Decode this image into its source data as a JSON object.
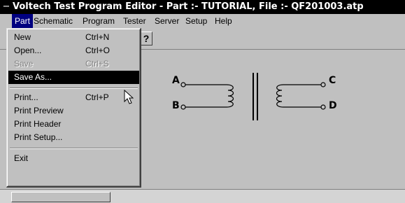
{
  "window": {
    "title": "Voltech Test Program Editor - Part :- TUTORIAL, File :- QF201003.atp",
    "system_icon": "minus-icon"
  },
  "menubar": {
    "items": [
      {
        "label": "Part"
      },
      {
        "label": "Schematic"
      },
      {
        "label": "Program"
      },
      {
        "label": "Tester"
      },
      {
        "label": "Server"
      },
      {
        "label": "Setup"
      },
      {
        "label": "Help"
      }
    ]
  },
  "toolbar": {
    "help_glyph": "?"
  },
  "part_menu": {
    "items": [
      {
        "label": "New",
        "shortcut": "Ctrl+N",
        "state": "enabled"
      },
      {
        "label": "Open...",
        "shortcut": "Ctrl+O",
        "state": "enabled"
      },
      {
        "label": "Save",
        "shortcut": "Ctrl+S",
        "state": "disabled"
      },
      {
        "label": "Save As...",
        "shortcut": "",
        "state": "selected"
      },
      {
        "label": "Print...",
        "shortcut": "Ctrl+P",
        "state": "enabled"
      },
      {
        "label": "Print Preview",
        "shortcut": "",
        "state": "enabled"
      },
      {
        "label": "Print Header",
        "shortcut": "",
        "state": "enabled"
      },
      {
        "label": "Print Setup...",
        "shortcut": "",
        "state": "enabled"
      },
      {
        "label": "Exit",
        "shortcut": "",
        "state": "enabled"
      }
    ]
  },
  "schematic": {
    "terminals": {
      "a": "A",
      "b": "B",
      "c": "C",
      "d": "D"
    }
  },
  "colors": {
    "title_bar": "#000000",
    "menu_active": "#000080",
    "menu_background": "#c0c0c0",
    "selected_item": "#000000"
  }
}
